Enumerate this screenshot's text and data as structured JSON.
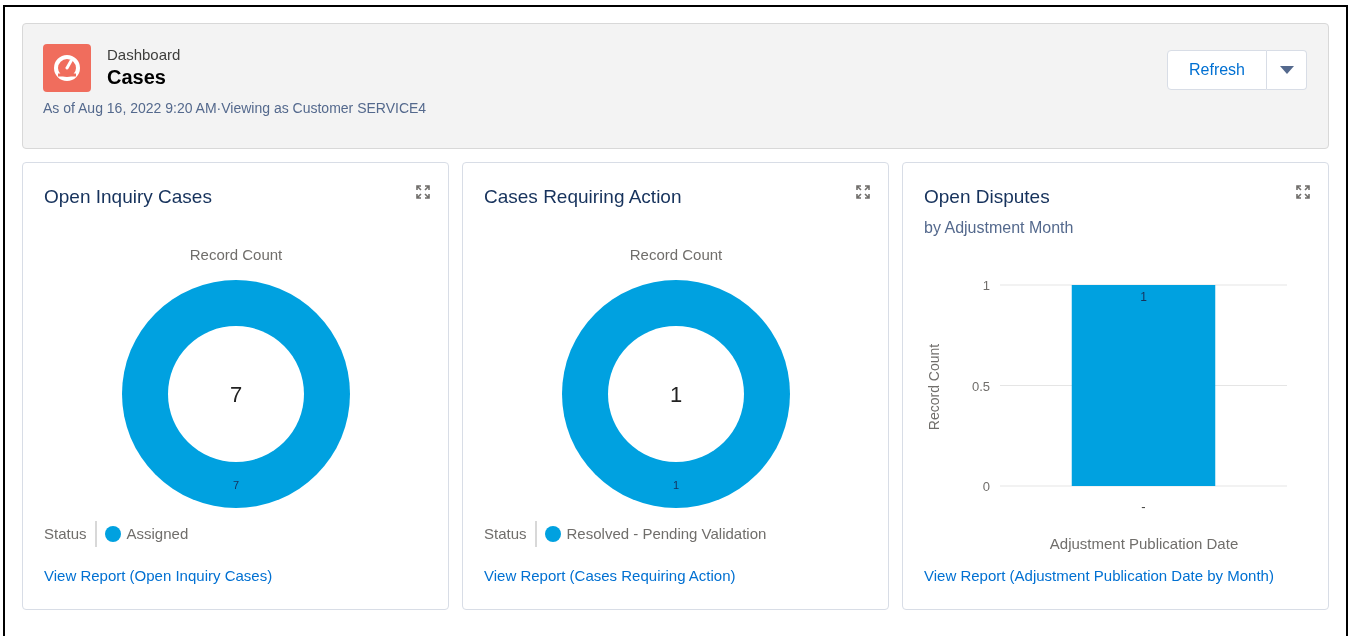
{
  "header": {
    "object_label": "Dashboard",
    "title": "Cases",
    "subtitle": "As of Aug 16, 2022 9:20 AM·Viewing as Customer SERVICE4",
    "refresh_button": "Refresh"
  },
  "widgets": [
    {
      "title": "Open Inquiry Cases",
      "center_total": "7",
      "legend_title": "Status",
      "link": "View Report (Open Inquiry Cases)",
      "chart_data": {
        "type": "donut",
        "title": "Record Count",
        "categories": [
          "Assigned"
        ],
        "series": [
          {
            "color": "#00a1e0",
            "values": [
              7
            ]
          }
        ],
        "data_labels": true
      }
    },
    {
      "title": "Cases Requiring Action",
      "center_total": "1",
      "legend_title": "Status",
      "link": "View Report (Cases Requiring Action)",
      "chart_data": {
        "type": "donut",
        "title": "Record Count",
        "categories": [
          "Resolved - Pending Validation"
        ],
        "series": [
          {
            "color": "#00a1e0",
            "values": [
              1
            ]
          }
        ],
        "data_labels": true
      }
    },
    {
      "title": "Open Disputes",
      "subtitle": "by Adjustment Month",
      "link": "View Report (Adjustment Publication Date by Month)",
      "chart_data": {
        "type": "bar",
        "xlabel": "Adjustment Publication Date",
        "ylabel": "Record Count",
        "categories": [
          "-"
        ],
        "series": [
          {
            "color": "#00a1e0",
            "values": [
              1
            ]
          }
        ],
        "ylim": [
          0,
          1
        ],
        "yticks": [
          0,
          0.5,
          1
        ],
        "data_labels": true
      }
    }
  ]
}
